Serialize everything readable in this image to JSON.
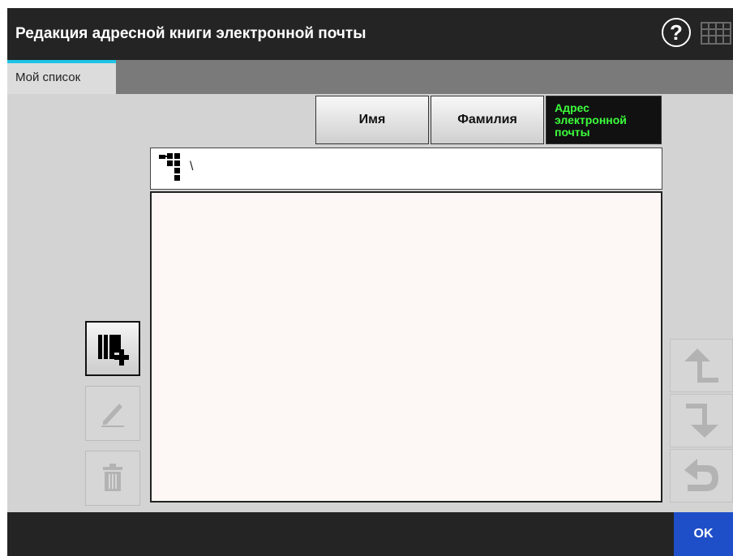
{
  "header": {
    "title": "Редакция адресной книги электронной почты",
    "help_label": "?",
    "help_icon": "help-icon",
    "keyboard_icon": "keyboard-icon"
  },
  "tabs": [
    {
      "label": "Мой список",
      "active": true
    }
  ],
  "columns": {
    "name_label": "Имя",
    "surname_label": "Фамилия",
    "email_label_line1": "Адрес",
    "email_label_line2": "электронной",
    "email_label_line3": "почты",
    "active_column": "email"
  },
  "path_bar": {
    "icon": "folder-tree-icon",
    "path": "\\"
  },
  "list": {
    "items": []
  },
  "side_buttons": {
    "add_icon": "add-entry-icon",
    "edit_icon": "edit-pencil-icon",
    "delete_icon": "trash-icon"
  },
  "arrow_buttons": {
    "up_icon": "arrow-up-icon",
    "down_icon": "arrow-down-icon",
    "back_icon": "back-icon"
  },
  "footer": {
    "ok_label": "OK"
  },
  "colors": {
    "titlebar": "#242424",
    "tab_accent": "#1ec3e6",
    "active_column_text": "#3cff3c",
    "ok_button": "#1f4fc8"
  }
}
